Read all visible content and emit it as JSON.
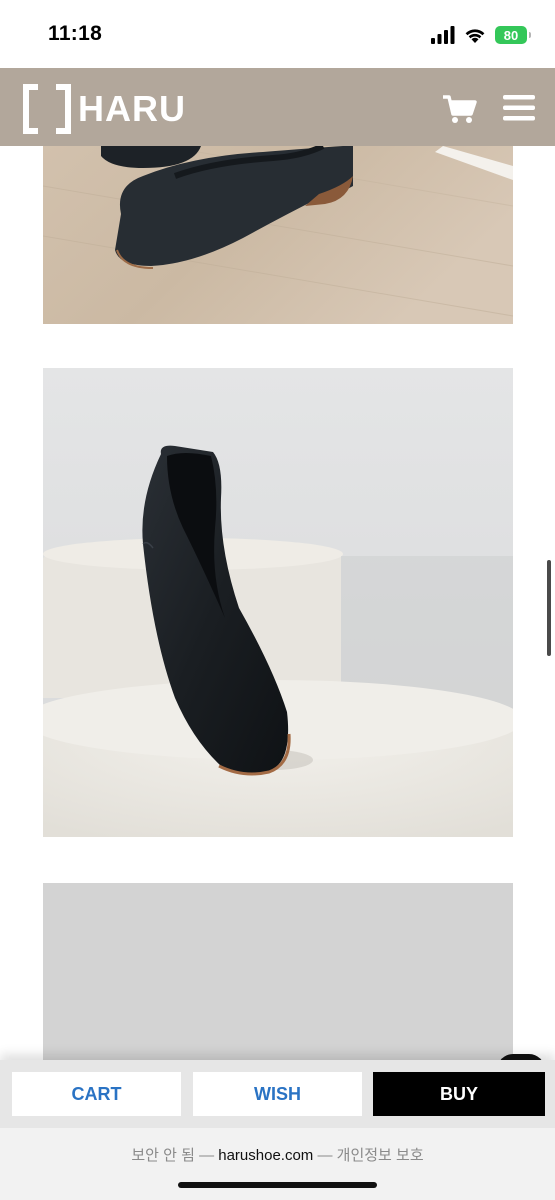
{
  "status_bar": {
    "time": "11:18",
    "battery": "80"
  },
  "header": {
    "logo_text": "HARU",
    "cart_icon": "shopping-cart-icon",
    "menu_icon": "hamburger-menu-icon",
    "background": "#b2a79b"
  },
  "actions": {
    "cart_label": "CART",
    "wish_label": "WISH",
    "buy_label": "BUY"
  },
  "address_bar": {
    "prefix": "보안 안 됨 — ",
    "domain": "harushoe.com",
    "suffix": " — 개인정보 보호"
  },
  "colors": {
    "accent_blue": "#2a73c4",
    "buy_black": "#000000",
    "battery_green": "#34c759"
  }
}
